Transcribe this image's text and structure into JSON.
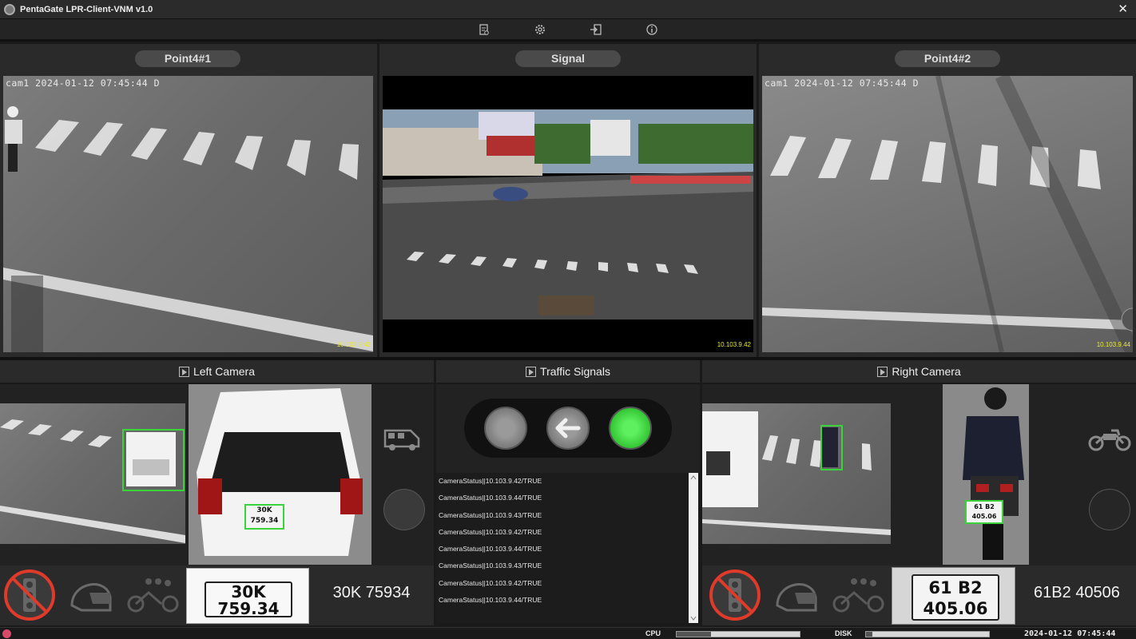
{
  "window": {
    "title": "PentaGate  LPR-Client-VNM v1.0",
    "close_glyph": "✕"
  },
  "toolbar": {
    "icons": [
      "report-icon",
      "gear-icon",
      "logout-icon",
      "info-icon"
    ]
  },
  "cameras": {
    "point1": {
      "label": "Point4#1",
      "stamp": "cam1 2024-01-12 07:45:44 D",
      "ip": "10.103.9.43"
    },
    "signal": {
      "label": "Signal",
      "ip": "10.103.9.42"
    },
    "point2": {
      "label": "Point4#2",
      "stamp": "cam1 2024-01-12 07:45:44 D",
      "ip": "10.103.9.44"
    }
  },
  "left_camera": {
    "title": "Left Camera",
    "vehicle_icon": "van-icon",
    "plate_image_text": [
      "30K",
      "759.34"
    ],
    "plate_number": "30K 75934",
    "thumb_plate": [
      "30K",
      "759.34"
    ]
  },
  "traffic_signals": {
    "title": "Traffic Signals",
    "lights": [
      {
        "name": "off",
        "color": "#8a8a8a"
      },
      {
        "name": "left-arrow",
        "color": "#8a8a8a"
      },
      {
        "name": "green",
        "color": "#3ee03e"
      }
    ],
    "log": [
      "CameraStatus||10.103.9.42/TRUE",
      "CameraStatus||10.103.9.44/TRUE",
      "CameraStatus||10.103.9.43/TRUE",
      "CameraStatus||10.103.9.42/TRUE",
      "CameraStatus||10.103.9.44/TRUE",
      "CameraStatus||10.103.9.43/TRUE",
      "CameraStatus||10.103.9.42/TRUE",
      "CameraStatus||10.103.9.44/TRUE"
    ]
  },
  "right_camera": {
    "title": "Right Camera",
    "vehicle_icon": "motorbike-icon",
    "plate_image_text": [
      "61 B2",
      "405.06"
    ],
    "plate_number": "61B2 40506",
    "thumb_plate": [
      "61 B2",
      "405.06"
    ]
  },
  "statusbar": {
    "cpu_label": "CPU",
    "cpu_level": 0.28,
    "disk_label": "DISK",
    "disk_level": 0.05,
    "clock": "2024-01-12 07:45:44"
  },
  "colors": {
    "detect_box": "#3bd33b",
    "no_signal_red": "#e03a2a",
    "ip_text": "#e8e830"
  }
}
